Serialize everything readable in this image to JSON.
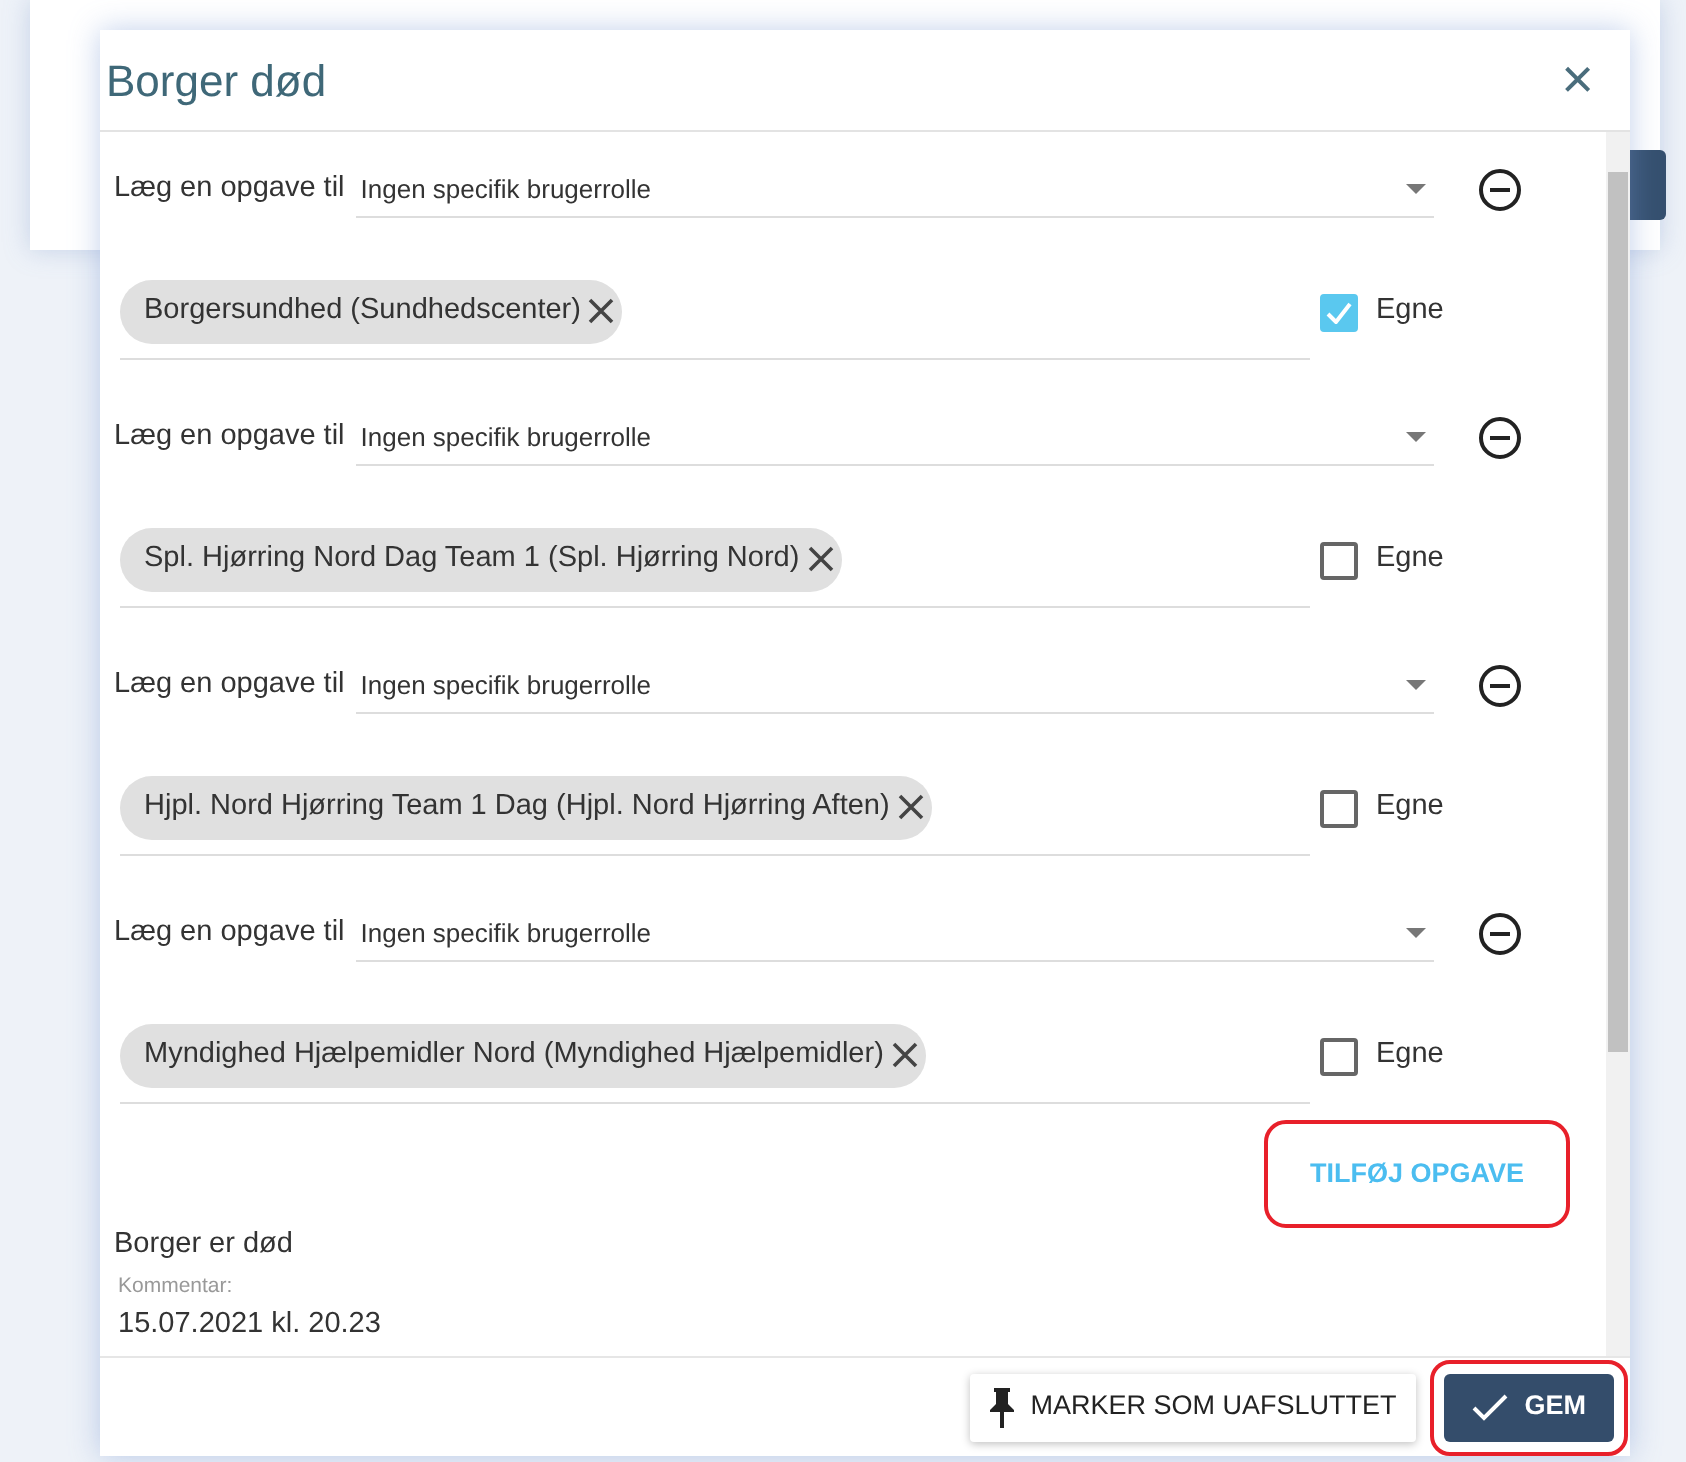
{
  "dialog": {
    "title": "Borger død",
    "close_glyph": "×"
  },
  "tasks": [
    {
      "label": "Læg en opgave til",
      "role": "Ingen specifik brugerrolle",
      "recipient": "Borgersundhed (Sundhedscenter)",
      "own_label": "Egne",
      "own_checked": true
    },
    {
      "label": "Læg en opgave til",
      "role": "Ingen specifik brugerrolle",
      "recipient": "Spl. Hjørring Nord Dag Team 1 (Spl. Hjørring Nord)",
      "own_label": "Egne",
      "own_checked": false
    },
    {
      "label": "Læg en opgave til",
      "role": "Ingen specifik brugerrolle",
      "recipient": "Hjpl. Nord Hjørring Team 1 Dag (Hjpl. Nord Hjørring Aften)",
      "own_label": "Egne",
      "own_checked": false
    },
    {
      "label": "Læg en opgave til",
      "role": "Ingen specifik brugerrolle",
      "recipient": "Myndighed Hjælpemidler Nord (Myndighed Hjælpemidler)",
      "own_label": "Egne",
      "own_checked": false
    }
  ],
  "add_task": {
    "label": "TILFØJ OPGAVE",
    "highlighted": true
  },
  "event": {
    "title": "Borger er død",
    "comment_label": "Kommentar:",
    "comment_value": "15.07.2021 kl. 20.23"
  },
  "footer": {
    "buttons": [
      {
        "kind": "secondary",
        "label": "MARKER SOM UAFSLUTTET",
        "highlighted": false
      },
      {
        "kind": "primary",
        "label": "GEM",
        "highlighted": true
      }
    ]
  }
}
